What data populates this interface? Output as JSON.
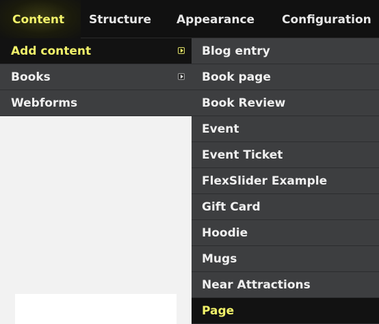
{
  "topbar": {
    "items": [
      {
        "label": "Content",
        "active": true
      },
      {
        "label": "Structure",
        "active": false
      },
      {
        "label": "Appearance",
        "active": false
      },
      {
        "label": "Configuration",
        "active": false
      }
    ]
  },
  "main_menu": {
    "items": [
      {
        "label": "Add content",
        "has_submenu": true,
        "active": true
      },
      {
        "label": "Books",
        "has_submenu": true,
        "active": false
      },
      {
        "label": "Webforms",
        "has_submenu": false,
        "active": false
      }
    ]
  },
  "sub_menu": {
    "items": [
      {
        "label": "Blog entry"
      },
      {
        "label": "Book page"
      },
      {
        "label": "Book Review"
      },
      {
        "label": "Event"
      },
      {
        "label": "Event Ticket"
      },
      {
        "label": "FlexSlider Example"
      },
      {
        "label": "Gift Card"
      },
      {
        "label": "Hoodie"
      },
      {
        "label": "Mugs"
      },
      {
        "label": "Near Attractions"
      },
      {
        "label": "Page",
        "highlighted": true
      }
    ]
  },
  "colors": {
    "accent_text": "#f2f26a",
    "menu_bg": "#3d3e40",
    "active_bg": "#121212",
    "topbar_bg": "#111111"
  }
}
